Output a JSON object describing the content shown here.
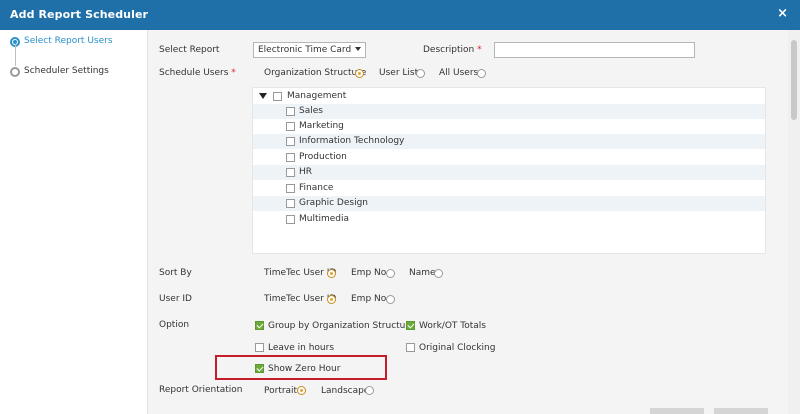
{
  "dialog": {
    "title": "Add Report Scheduler",
    "close_label": "×"
  },
  "steps": [
    {
      "label": "Select Report Users"
    },
    {
      "label": "Scheduler Settings"
    }
  ],
  "form": {
    "select_report_label": "Select Report",
    "select_report_value": "Electronic Time Card",
    "description_label": "Description",
    "description_required": "*",
    "description_value": "",
    "schedule_users_label": "Schedule Users",
    "schedule_users_required": "*",
    "schedule_users_options": [
      "Organization Structure",
      "User List",
      "All Users"
    ],
    "tree": {
      "root": "Management",
      "children": [
        "Sales",
        "Marketing",
        "Information Technology",
        "Production",
        "HR",
        "Finance",
        "Graphic Design",
        "Multimedia"
      ]
    },
    "sort_by_label": "Sort By",
    "sort_by_options": [
      "TimeTec User ID",
      "Emp No.",
      "Name"
    ],
    "user_id_label": "User ID",
    "user_id_options": [
      "TimeTec User ID",
      "Emp No."
    ],
    "option_label": "Option",
    "options": {
      "group_by_org": "Group by Organization Structure",
      "work_ot_totals": "Work/OT Totals",
      "leave_in_hours": "Leave in hours",
      "original_clocking": "Original Clocking",
      "show_zero_hour": "Show Zero Hour"
    },
    "orientation_label": "Report Orientation",
    "orientation_options": [
      "Portrait",
      "Landscape"
    ]
  }
}
